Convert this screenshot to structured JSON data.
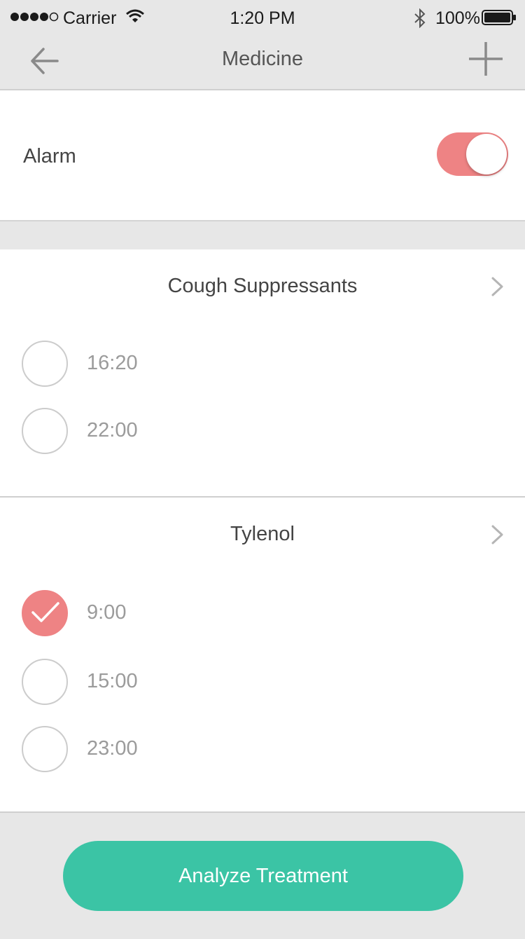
{
  "status_bar": {
    "carrier": "Carrier",
    "time": "1:20 PM",
    "battery": "100%"
  },
  "nav": {
    "title": "Medicine",
    "back_icon": "arrow-left-icon",
    "add_icon": "plus-icon"
  },
  "alarm": {
    "label": "Alarm",
    "enabled": true
  },
  "medicines": [
    {
      "name": "Cough Suppressants",
      "doses": [
        {
          "time": "16:20",
          "taken": false
        },
        {
          "time": "22:00",
          "taken": false
        }
      ]
    },
    {
      "name": "Tylenol",
      "doses": [
        {
          "time": "9:00",
          "taken": true
        },
        {
          "time": "15:00",
          "taken": false
        },
        {
          "time": "23:00",
          "taken": false
        }
      ]
    }
  ],
  "footer": {
    "analyze_label": "Analyze Treatment"
  },
  "colors": {
    "accent": "#ee8384",
    "primary_button": "#3bc4a5",
    "background": "#e7e7e7"
  }
}
